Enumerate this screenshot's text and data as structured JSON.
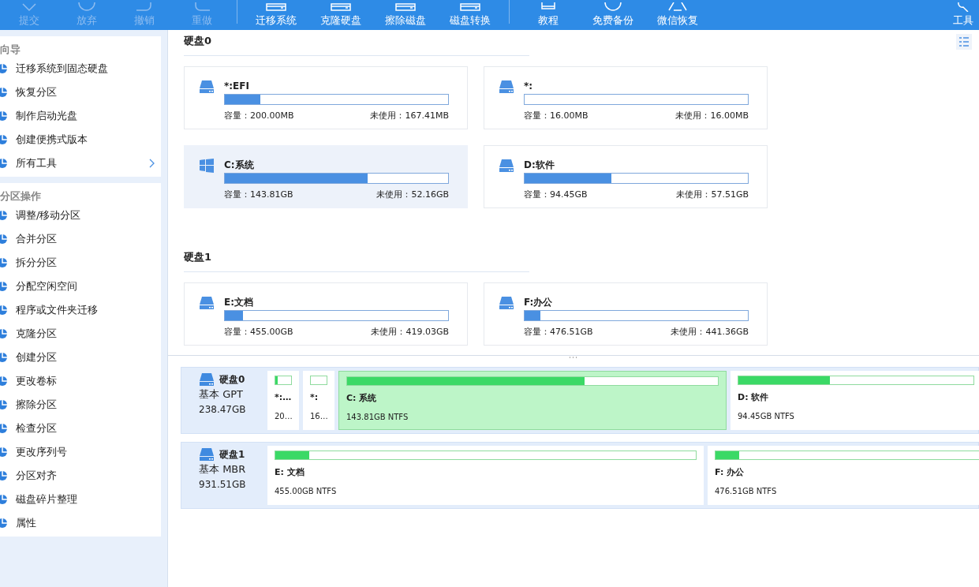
{
  "toolbar": {
    "groups": [
      [
        {
          "label": "提交",
          "disabled": true,
          "kind": "check"
        },
        {
          "label": "放弃",
          "disabled": true,
          "kind": "discard"
        },
        {
          "label": "撤销",
          "disabled": true,
          "kind": "undo"
        },
        {
          "label": "重做",
          "disabled": true,
          "kind": "redo"
        }
      ],
      [
        {
          "label": "迁移系统",
          "disabled": false,
          "kind": "drive"
        },
        {
          "label": "克隆硬盘",
          "disabled": false,
          "kind": "drive"
        },
        {
          "label": "擦除磁盘",
          "disabled": false,
          "kind": "drive"
        },
        {
          "label": "磁盘转换",
          "disabled": false,
          "kind": "drive"
        }
      ],
      [
        {
          "label": "教程",
          "disabled": false,
          "kind": "book"
        },
        {
          "label": "免费备份",
          "disabled": false,
          "kind": "backup"
        },
        {
          "label": "微信恢复",
          "disabled": false,
          "kind": "recover"
        }
      ]
    ],
    "tools": {
      "label": "工具"
    }
  },
  "sidebar": {
    "sections": [
      {
        "title": "向导",
        "items": [
          {
            "label": "迁移系统到固态硬盘",
            "chevron": false
          },
          {
            "label": "恢复分区",
            "chevron": false
          },
          {
            "label": "制作启动光盘",
            "chevron": false
          },
          {
            "label": "创建便携式版本",
            "chevron": false
          },
          {
            "label": "所有工具",
            "chevron": true
          }
        ]
      },
      {
        "title": "分区操作",
        "items": [
          {
            "label": "调整/移动分区",
            "chevron": false
          },
          {
            "label": "合并分区",
            "chevron": false
          },
          {
            "label": "拆分分区",
            "chevron": false
          },
          {
            "label": "分配空闲空间",
            "chevron": false
          },
          {
            "label": "程序或文件夹迁移",
            "chevron": false
          },
          {
            "label": "克隆分区",
            "chevron": false
          },
          {
            "label": "创建分区",
            "chevron": false
          },
          {
            "label": "更改卷标",
            "chevron": false
          },
          {
            "label": "擦除分区",
            "chevron": false
          },
          {
            "label": "检查分区",
            "chevron": false
          },
          {
            "label": "更改序列号",
            "chevron": false
          },
          {
            "label": "分区对齐",
            "chevron": false
          },
          {
            "label": "磁盘碎片整理",
            "chevron": false
          },
          {
            "label": "属性",
            "chevron": false
          }
        ]
      }
    ]
  },
  "disks": [
    {
      "title": "硬盘0",
      "partitions": [
        {
          "name": "*:EFI",
          "kind": "drive",
          "selected": false,
          "level": 0.16,
          "capacity": "容量：200.00MB",
          "unused": "未使用：167.41MB"
        },
        {
          "name": "*:",
          "kind": "drive",
          "selected": false,
          "capacity": "容量：16.00MB",
          "unused": "未使用：16.00MB"
        },
        {
          "name": "C:系统",
          "kind": "windows",
          "selected": true,
          "level": 0.64,
          "capacity": "容量：143.81GB",
          "unused": "未使用：52.16GB"
        },
        {
          "name": "D:软件",
          "kind": "drive",
          "selected": false,
          "level": 0.39,
          "capacity": "容量：94.45GB",
          "unused": "未使用：57.51GB"
        }
      ]
    },
    {
      "title": "硬盘1",
      "partitions": [
        {
          "name": "E:文档",
          "kind": "drive",
          "selected": false,
          "level": 0.08,
          "capacity": "容量：455.00GB",
          "unused": "未使用：419.03GB"
        },
        {
          "name": "F:办公",
          "kind": "drive",
          "selected": false,
          "level": 0.07,
          "capacity": "容量：476.51GB",
          "unused": "未使用：441.36GB"
        }
      ]
    }
  ],
  "disk_map": [
    {
      "name": "硬盘0",
      "type": "基本 GPT",
      "size": "238.47GB",
      "partitions": [
        {
          "name": "*:…",
          "info": "20…",
          "selected": false,
          "level": 0.16
        },
        {
          "name": "*:",
          "info": "16…",
          "selected": false
        },
        {
          "name": "C: 系统",
          "info": "143.81GB NTFS",
          "selected": true,
          "level": 0.64
        },
        {
          "name": "D: 软件",
          "info": "94.45GB NTFS",
          "selected": false,
          "level": 0.39
        }
      ]
    },
    {
      "name": "硬盘1",
      "type": "基本 MBR",
      "size": "931.51GB",
      "partitions": [
        {
          "name": "E: 文档",
          "info": "455.00GB NTFS",
          "selected": false,
          "level": 0.08
        },
        {
          "name": "F: 办公",
          "info": "476.51GB NTFS",
          "selected": false,
          "level": 0.07
        }
      ]
    }
  ]
}
